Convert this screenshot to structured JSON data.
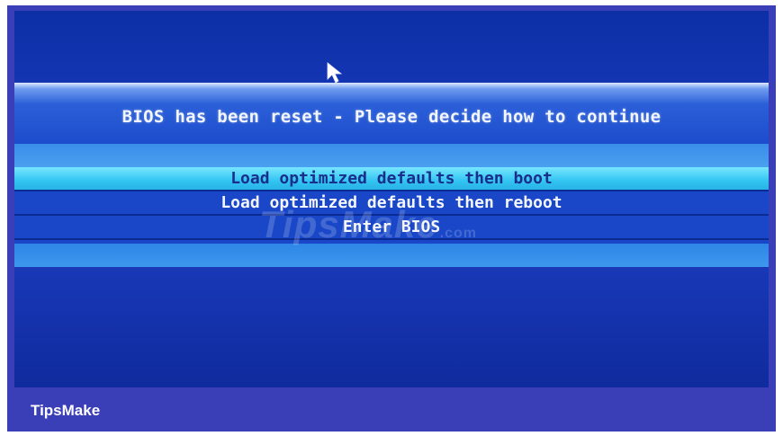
{
  "dialog": {
    "title": "BIOS has been reset - Please decide how to continue",
    "options": [
      {
        "label": "Load optimized defaults then boot",
        "selected": true
      },
      {
        "label": "Load optimized defaults then reboot",
        "selected": false
      },
      {
        "label": "Enter BIOS",
        "selected": false
      }
    ]
  },
  "watermark": {
    "text": "TipsMake",
    "suffix": ".com"
  },
  "caption": {
    "text": "TipsMake"
  },
  "colors": {
    "screen_background": "#1a3bbd",
    "selected_highlight": "#33c5f2",
    "frame": "#3a3fb8",
    "text": "#f4f7ff"
  },
  "icons": {
    "pointer": "mouse-pointer-icon"
  }
}
